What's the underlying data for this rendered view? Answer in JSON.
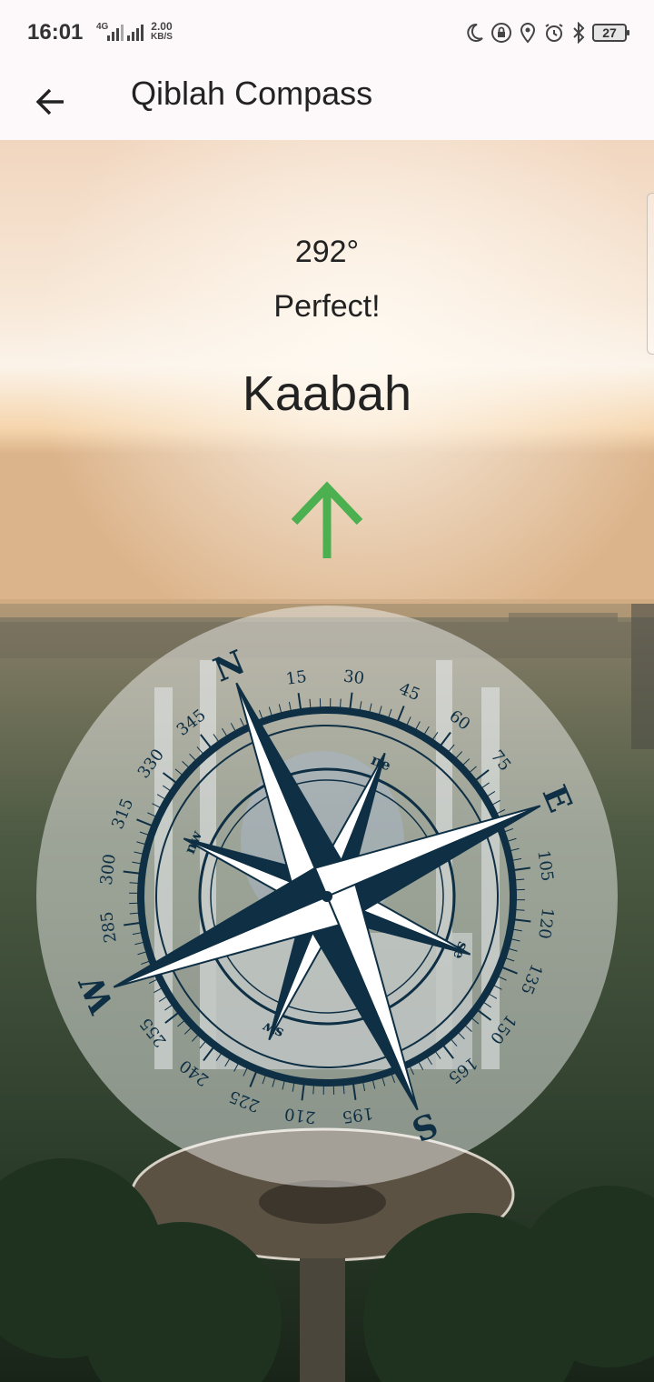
{
  "status_bar": {
    "time": "16:01",
    "network_type_top": "4G",
    "network_speed": "2.00",
    "network_speed_unit": "KB/S",
    "battery": "27",
    "icons": [
      "moon-icon",
      "lock-icon",
      "location-icon",
      "alarm-icon",
      "bluetooth-icon",
      "battery-icon"
    ]
  },
  "app_bar": {
    "title": "Qiblah Compass",
    "back_icon": "arrow-left-icon"
  },
  "qiblah": {
    "degrees": "292°",
    "status": "Perfect!",
    "target": "Kaabah",
    "arrow_icon": "arrow-up-icon",
    "arrow_color": "#4caf50"
  },
  "compass": {
    "cardinals": [
      "N",
      "E",
      "S",
      "W"
    ],
    "intercardinals": [
      "ne",
      "se",
      "sw",
      "nw"
    ],
    "degree_labels": [
      "15",
      "30",
      "45",
      "60",
      "75",
      "105",
      "120",
      "135",
      "150",
      "165",
      "195",
      "210",
      "225",
      "240",
      "255",
      "285",
      "300",
      "315",
      "330",
      "345"
    ],
    "rose_color": "#0e2f44"
  }
}
